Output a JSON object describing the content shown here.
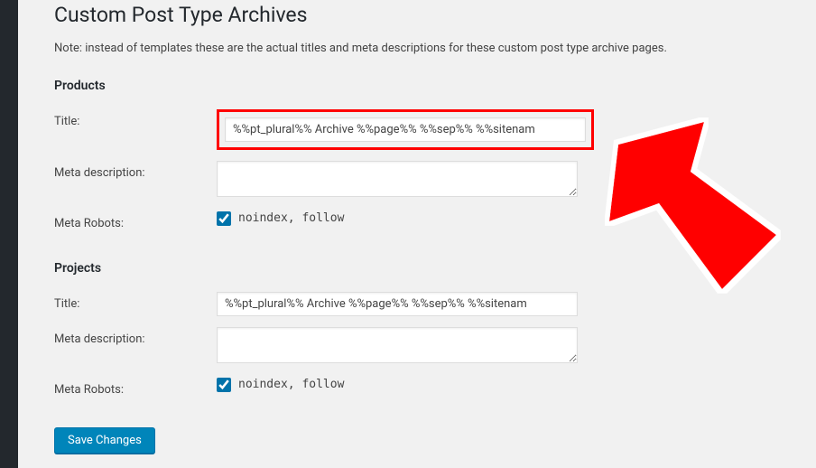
{
  "header": {
    "title": "Custom Post Type Archives",
    "note": "Note: instead of templates these are the actual titles and meta descriptions for these custom post type archive pages."
  },
  "sections": {
    "products": {
      "heading": "Products",
      "title_label": "Title:",
      "title_value": "%%pt_plural%% Archive %%page%% %%sep%% %%sitenam",
      "meta_desc_label": "Meta description:",
      "meta_desc_value": "",
      "meta_robots_label": "Meta Robots:",
      "meta_robots_checked": true,
      "meta_robots_text": "noindex, follow"
    },
    "projects": {
      "heading": "Projects",
      "title_label": "Title:",
      "title_value": "%%pt_plural%% Archive %%page%% %%sep%% %%sitenam",
      "meta_desc_label": "Meta description:",
      "meta_desc_value": "",
      "meta_robots_label": "Meta Robots:",
      "meta_robots_checked": true,
      "meta_robots_text": "noindex, follow"
    }
  },
  "buttons": {
    "save": "Save Changes"
  }
}
